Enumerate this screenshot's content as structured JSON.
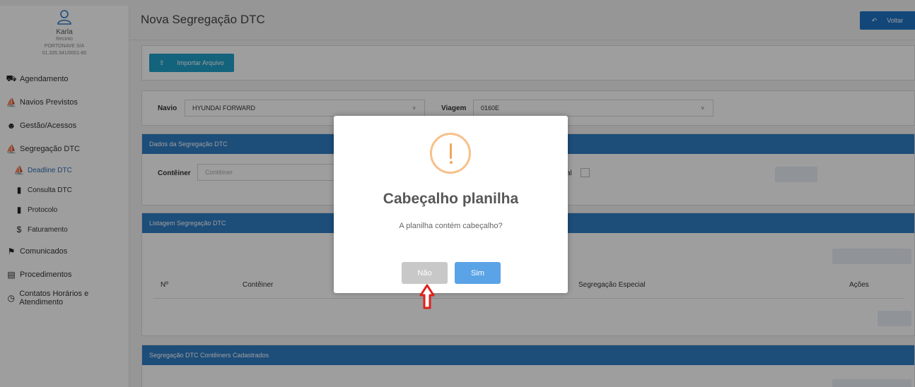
{
  "sidebar": {
    "user_name": "Karla",
    "user_role": "Recinto",
    "company": "PORTONAVE S/A",
    "cnpj": "01.335.341/0001-80",
    "items": [
      {
        "label": "Agendamento",
        "icon": "truck-icon"
      },
      {
        "label": "Navios Previstos",
        "icon": "ship-icon"
      },
      {
        "label": "Gestão/Acessos",
        "icon": "users-icon"
      },
      {
        "label": "Segregação DTC",
        "icon": "ship-icon"
      },
      {
        "label": "Deadline DTC",
        "icon": "ship-icon"
      },
      {
        "label": "Consulta DTC",
        "icon": "file-icon"
      },
      {
        "label": "Protocolo",
        "icon": "file-icon"
      },
      {
        "label": "Faturamento",
        "icon": "dollar-icon"
      },
      {
        "label": "Comunicados",
        "icon": "bookmark-icon"
      },
      {
        "label": "Procedimentos",
        "icon": "document-icon"
      },
      {
        "label": "Contatos Horários e Atendimento",
        "icon": "clock-icon"
      }
    ]
  },
  "header": {
    "title": "Nova Segregação DTC",
    "back_label": "Voltar"
  },
  "import": {
    "label": "Importar Arquivo"
  },
  "filters": {
    "navio_label": "Navio",
    "navio_value": "HYUNDAI FORWARD",
    "viagem_label": "Viagem",
    "viagem_value": "0160E"
  },
  "dados": {
    "title": "Dados da Segregação DTC",
    "container_label": "Contêiner",
    "container_placeholder": "Contêiner",
    "especial_label_fragment": "al"
  },
  "listagem": {
    "title": "Listagem Segregação DTC",
    "columns": [
      "Nº",
      "Contêiner",
      "Segregação Especial",
      "Ações"
    ]
  },
  "cadastrados": {
    "title": "Segregação DTC Contêiners Cadastrados"
  },
  "modal": {
    "title": "Cabeçalho planilha",
    "message": "A planilha contém cabeçalho?",
    "no_label": "Não",
    "yes_label": "Sim"
  },
  "colors": {
    "primary": "#2f7cc4",
    "button_blue": "#1f73c4",
    "import_teal": "#1fa0c8",
    "warning": "#f3a65b",
    "sim_button": "#5aa3e6",
    "nao_button": "#c8c8c8",
    "arrow_red": "#e0201b"
  }
}
